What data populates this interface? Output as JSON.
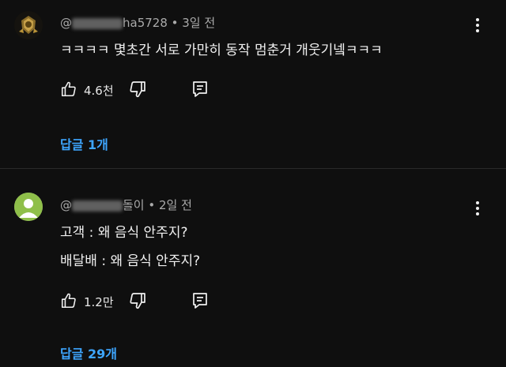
{
  "comments": [
    {
      "handle_visible": "@",
      "handle_suffix": "ha5728",
      "age": "3일 전",
      "text": "ㅋㅋㅋㅋ 몇초간 서로 가만히 동작 멈춘거 개웃기넼ㅋㅋㅋ",
      "likes": "4.6천",
      "replies_label": "답글 1개"
    },
    {
      "handle_visible": "@",
      "handle_suffix": "돌이",
      "age": "2일 전",
      "lines": [
        "고객 : 왜 음식 안주지?",
        "배달배 : 왜 음식 안주지?"
      ],
      "likes": "1.2만",
      "replies_label": "답글 29개"
    }
  ],
  "meta_separator": " • ",
  "icons": {
    "like": "thumb-up-icon",
    "dislike": "thumb-down-icon",
    "reply": "reply-icon",
    "more": "more-vertical-icon",
    "avatar1": "badge-avatar-icon",
    "avatar2": "default-user-avatar-icon"
  },
  "colors": {
    "background": "#0f0f0f",
    "text": "#f1f1f1",
    "meta": "#aaaaaa",
    "link": "#3ea6ff"
  }
}
